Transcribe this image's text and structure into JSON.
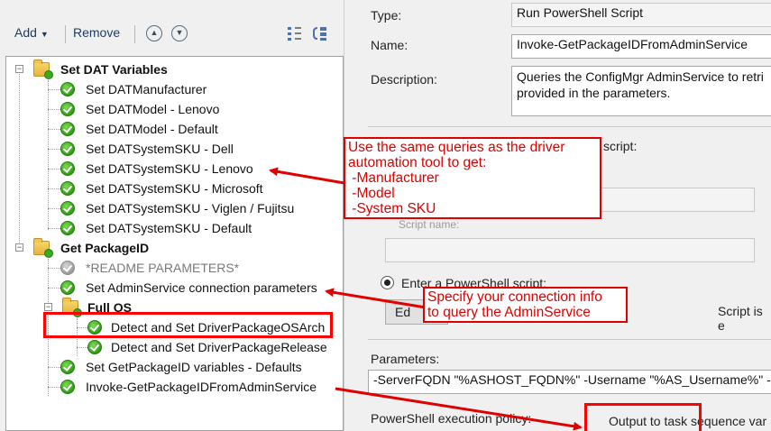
{
  "toolbar": {
    "add_label": "Add",
    "remove_label": "Remove"
  },
  "tree": {
    "groups": [
      {
        "label": "Set DAT Variables"
      },
      {
        "label": "Get PackageID"
      },
      {
        "label": "Full OS"
      }
    ],
    "steps": {
      "s1": "Set DATManufacturer",
      "s2": "Set DATModel - Lenovo",
      "s3": "Set DATModel - Default",
      "s4": "Set DATSystemSKU - Dell",
      "s5": "Set DATSystemSKU - Lenovo",
      "s6": "Set DATSystemSKU - Microsoft",
      "s7": "Set DATSystemSKU - Viglen / Fujitsu",
      "s8": "Set DATSystemSKU - Default",
      "s9": "*README PARAMETERS*",
      "s10": "Set AdminService connection parameters",
      "s11": "Detect and Set DriverPackageOSArch",
      "s12": "Detect and Set DriverPackageRelease",
      "s13": "Set GetPackageID variables - Defaults",
      "s14": "Invoke-GetPackageIDFromAdminService"
    }
  },
  "form": {
    "type_label": "Type:",
    "type_value": "Run PowerShell Script",
    "name_label": "Name:",
    "name_value": "Invoke-GetPackageIDFromAdminService",
    "desc_label": "Description:",
    "desc_line1": "Queries the ConfigMgr AdminService to retri",
    "desc_line2": "provided in the parameters.",
    "script_label_partial": "l script:",
    "script_name_label": "Script name:",
    "radio_label": "Enter a PowerShell script:",
    "edit_button": "Ed",
    "script_status": "Script is e",
    "parameters_label": "Parameters:",
    "parameters_value": "-ServerFQDN \"%ASHOST_FQDN%\" -Username \"%AS_Username%\" -P",
    "policy_label": "PowerShell execution policy:",
    "output_label": "Output to task sequence var"
  },
  "callouts": {
    "c1": "Use the same queries as the driver\nautomation tool to get:\n -Manufacturer\n -Model\n -System SKU",
    "c2": "Specify your connection info\nto query the AdminService"
  },
  "colors": {
    "accent_red": "#ff0000",
    "link_blue": "#1e395b"
  }
}
